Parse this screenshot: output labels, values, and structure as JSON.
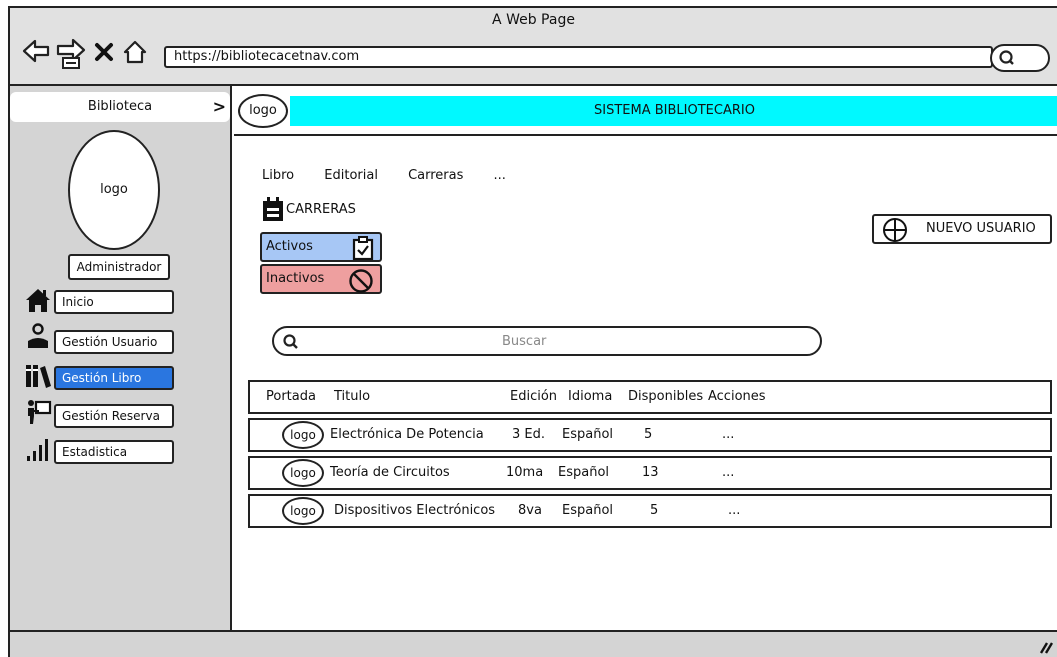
{
  "window": {
    "title": "A Web Page"
  },
  "browser": {
    "url": "https://bibliotecacetnav.com"
  },
  "sidebar": {
    "header": "Biblioteca",
    "logo": "logo",
    "role": "Administrador",
    "items": [
      {
        "label": "Inicio",
        "icon": "home-icon"
      },
      {
        "label": "Gestión Usuario",
        "icon": "user-icon"
      },
      {
        "label": "Gestión Libro",
        "icon": "books-icon",
        "active": true
      },
      {
        "label": "Gestión Reserva",
        "icon": "reserve-icon"
      },
      {
        "label": "Estadistica",
        "icon": "stats-icon"
      }
    ]
  },
  "main": {
    "logo": "logo",
    "banner": "SISTEMA BIBLIOTECARIO",
    "tabs": [
      "Libro",
      "Editorial",
      "Carreras",
      "..."
    ],
    "section_title": "CARRERAS",
    "activos_label": "Activos",
    "inactivos_label": "Inactivos",
    "new_user_label": "NUEVO USUARIO",
    "search_placeholder": "Buscar",
    "table": {
      "headers": [
        "Portada",
        "Titulo",
        "Edición",
        "Idioma",
        "Disponibles",
        "Acciones"
      ],
      "rows": [
        {
          "portada": "logo",
          "titulo": "Electrónica De Potencia",
          "edicion": "3 Ed.",
          "idioma": "Español",
          "disponibles": "5",
          "acciones": "..."
        },
        {
          "portada": "logo",
          "titulo": "Teoría de Circuitos",
          "edicion": "10ma",
          "idioma": "Español",
          "disponibles": "13",
          "acciones": "..."
        },
        {
          "portada": "logo",
          "titulo": "Dispositivos Electrónicos",
          "edicion": "8va",
          "idioma": "Español",
          "disponibles": "5",
          "acciones": "..."
        }
      ]
    }
  },
  "colors": {
    "banner": "#00f9ff",
    "active_menu": "#2a76e0",
    "activos": "#a7c7f5",
    "inactivos": "#ee9f9f",
    "chrome": "#d4d4d4"
  }
}
